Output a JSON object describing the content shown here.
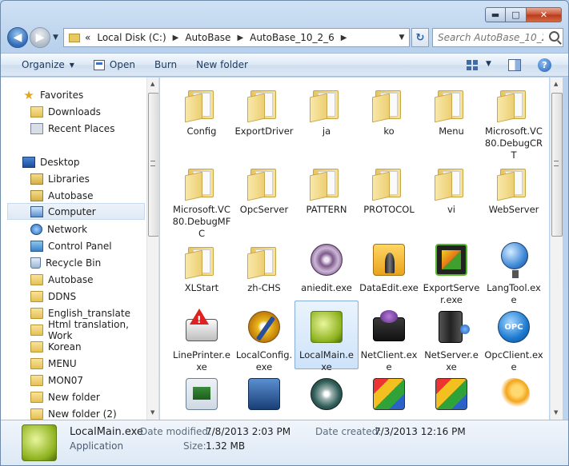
{
  "window": {
    "caption": {
      "minimize": "▬",
      "maximize": "□",
      "close": "✕"
    }
  },
  "nav": {
    "back": "◀",
    "forward": "▶",
    "recent": "▼",
    "breadcrumb": {
      "overflow": "«",
      "items": [
        "Local Disk (C:)",
        "AutoBase",
        "AutoBase_10_2_6"
      ],
      "sep": "▶"
    },
    "address_dropdown": "▼",
    "refresh": "↻",
    "search_placeholder": "Search AutoBase_10_2_6"
  },
  "commands": {
    "organize": "Organize",
    "organize_arrow": "▼",
    "open": "Open",
    "burn": "Burn",
    "new_folder": "New folder",
    "view_arrow": "▼",
    "help": "?"
  },
  "navpane": {
    "items": [
      {
        "label": "Favorites",
        "icon": "star-icon"
      },
      {
        "label": "Downloads",
        "icon": "downloads-icon"
      },
      {
        "label": "Recent Places",
        "icon": "recent-places-icon"
      },
      {
        "label": "Desktop",
        "icon": "desktop-icon"
      },
      {
        "label": "Libraries",
        "icon": "libraries-icon"
      },
      {
        "label": "Autobase",
        "icon": "library-folder-icon"
      },
      {
        "label": "Computer",
        "icon": "computer-icon"
      },
      {
        "label": "Network",
        "icon": "network-icon"
      },
      {
        "label": "Control Panel",
        "icon": "control-panel-icon"
      },
      {
        "label": "Recycle Bin",
        "icon": "recycle-bin-icon"
      },
      {
        "label": "Autobase",
        "icon": "folder-icon"
      },
      {
        "label": "DDNS",
        "icon": "folder-icon"
      },
      {
        "label": "English_translate",
        "icon": "folder-icon"
      },
      {
        "label": "Html translation, Work",
        "icon": "folder-icon"
      },
      {
        "label": "Korean",
        "icon": "folder-icon"
      },
      {
        "label": "MENU",
        "icon": "folder-icon"
      },
      {
        "label": "MON07",
        "icon": "folder-icon"
      },
      {
        "label": "New folder",
        "icon": "folder-icon"
      },
      {
        "label": "New folder (2)",
        "icon": "folder-icon"
      }
    ],
    "selected": "Computer"
  },
  "files": {
    "row1": [
      {
        "name": "Config",
        "type": "folder"
      },
      {
        "name": "ExportDriver",
        "type": "folder"
      },
      {
        "name": "ja",
        "type": "folder"
      },
      {
        "name": "ko",
        "type": "folder"
      },
      {
        "name": "Menu",
        "type": "folder"
      },
      {
        "name": "Microsoft.VC80.DebugCRT",
        "type": "folder"
      }
    ],
    "row2": [
      {
        "name": "Microsoft.VC80.DebugMFC",
        "type": "folder"
      },
      {
        "name": "OpcServer",
        "type": "folder"
      },
      {
        "name": "PATTERN",
        "type": "folder"
      },
      {
        "name": "PROTOCOL",
        "type": "folder"
      },
      {
        "name": "vi",
        "type": "folder"
      },
      {
        "name": "WebServer",
        "type": "folder"
      }
    ],
    "row3": [
      {
        "name": "XLStart",
        "type": "folder"
      },
      {
        "name": "zh-CHS",
        "type": "folder"
      },
      {
        "name": "aniedit.exe",
        "type": "aniedit"
      },
      {
        "name": "DataEdit.exe",
        "type": "dataedit"
      },
      {
        "name": "ExportServer.exe",
        "type": "exportserver"
      },
      {
        "name": "LangTool.exe",
        "type": "globe"
      }
    ],
    "row4": [
      {
        "name": "LinePrinter.exe",
        "type": "printer"
      },
      {
        "name": "LocalConfig.exe",
        "type": "config"
      },
      {
        "name": "LocalMain.exe",
        "type": "green",
        "selected": true
      },
      {
        "name": "NetClient.exe",
        "type": "netclient"
      },
      {
        "name": "NetServer.exe",
        "type": "netserver"
      },
      {
        "name": "OpcClient.exe",
        "type": "opc",
        "badge": "OPC"
      }
    ],
    "row5": [
      {
        "type": "screen"
      },
      {
        "type": "monitor"
      },
      {
        "type": "disc"
      },
      {
        "type": "blocks"
      },
      {
        "type": "blocks"
      },
      {
        "type": "dots"
      }
    ]
  },
  "details": {
    "name": "LocalMain.exe",
    "type": "Application",
    "modified_label": "Date modified:",
    "modified": "7/8/2013 2:03 PM",
    "size_label": "Size:",
    "size": "1.32 MB",
    "created_label": "Date created:",
    "created": "7/3/2013 12:16 PM"
  },
  "scroll": {
    "up": "▲",
    "down": "▼"
  }
}
